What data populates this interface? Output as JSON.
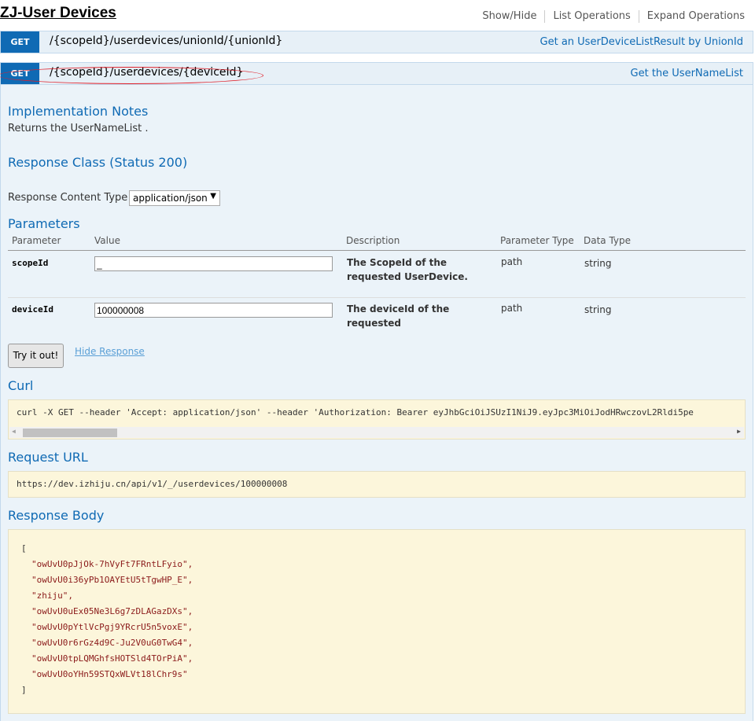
{
  "header": {
    "title": "ZJ-User Devices",
    "links": [
      "Show/Hide",
      "List Operations",
      "Expand Operations"
    ]
  },
  "operations": [
    {
      "method": "GET",
      "path": "/{scopeId}/userdevices/unionId/{unionId}",
      "summary": "Get an UserDeviceListResult by UnionId"
    },
    {
      "method": "GET",
      "path": "/{scopeId}/userdevices/{deviceId}",
      "summary": "Get the UserNameList"
    }
  ],
  "impl": {
    "heading": "Implementation Notes",
    "text": "Returns the UserNameList ."
  },
  "response_class": {
    "heading": "Response Class (Status 200)"
  },
  "content_type": {
    "label": "Response Content Type",
    "selected": "application/json"
  },
  "parameters": {
    "heading": "Parameters",
    "columns": [
      "Parameter",
      "Value",
      "Description",
      "Parameter Type",
      "Data Type"
    ],
    "rows": [
      {
        "name": "scopeId",
        "value": "_",
        "description": "The ScopeId of the requested UserDevice.",
        "param_type": "path",
        "data_type": "string"
      },
      {
        "name": "deviceId",
        "value": "100000008",
        "description": "The deviceId of the requested",
        "param_type": "path",
        "data_type": "string"
      }
    ]
  },
  "actions": {
    "try_label": "Try it out!",
    "hide_label": "Hide Response"
  },
  "curl": {
    "heading": "Curl",
    "command": "curl -X GET --header 'Accept: application/json' --header 'Authorization: Bearer eyJhbGciOiJSUzI1NiJ9.eyJpc3MiOiJodHRwczovL2Rldi5pe"
  },
  "request_url": {
    "heading": "Request URL",
    "url": "https://dev.izhiju.cn/api/v1/_/userdevices/100000008"
  },
  "response_body": {
    "heading": "Response Body",
    "open": "[",
    "items": [
      "\"owUvU0pJjOk-7hVyFt7FRntLFyio\",",
      "\"owUvU0i36yPb1OAYEtU5tTgwHP_E\",",
      "\"zhiju\",",
      "\"owUvU0uEx05Ne3L6g7zDLAGazDXs\",",
      "\"owUvU0pYtlVcPgj9YRcrU5n5voxE\",",
      "\"owUvU0r6rGz4d9C-Ju2V0uG0TwG4\",",
      "\"owUvU0tpLQMGhfsHOTSld4TOrPiA\",",
      "\"owUvU0oYHn59STQxWLVt18lChr9s\""
    ],
    "close": "]"
  }
}
